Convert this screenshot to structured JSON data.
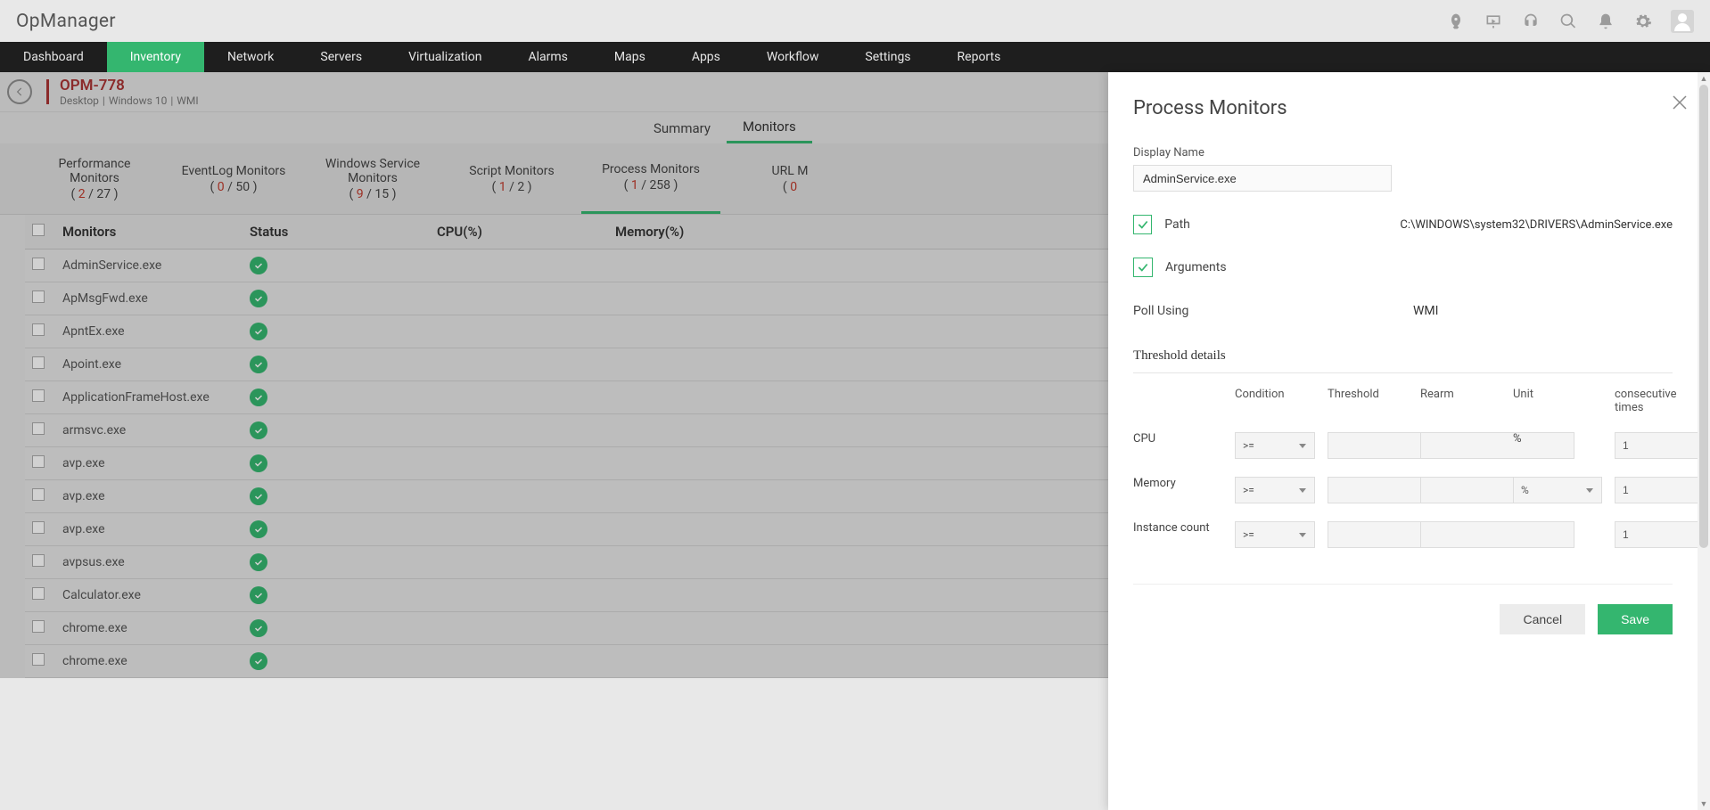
{
  "brand": "OpManager",
  "nav": [
    "Dashboard",
    "Inventory",
    "Network",
    "Servers",
    "Virtualization",
    "Alarms",
    "Maps",
    "Apps",
    "Workflow",
    "Settings",
    "Reports"
  ],
  "nav_active": 1,
  "device": {
    "name": "OPM-778",
    "meta": [
      "Desktop",
      "Windows 10",
      "WMI"
    ]
  },
  "subtabs": [
    "Summary",
    "Monitors"
  ],
  "subtab_active": 1,
  "mcats": [
    {
      "l1": "Performance",
      "l2": "Monitors",
      "a": "2",
      "b": "27"
    },
    {
      "l1": "EventLog Monitors",
      "l2": "",
      "a": "0",
      "b": "50"
    },
    {
      "l1": "Windows Service",
      "l2": "Monitors",
      "a": "9",
      "b": "15"
    },
    {
      "l1": "Script Monitors",
      "l2": "",
      "a": "1",
      "b": "2"
    },
    {
      "l1": "Process Monitors",
      "l2": "",
      "a": "1",
      "b": "258"
    },
    {
      "l1": "URL M",
      "l2": "",
      "a": "0",
      "b": ""
    }
  ],
  "mcat_active": 4,
  "table": {
    "headers": [
      "Monitors",
      "Status",
      "CPU(%)",
      "Memory(%)"
    ],
    "rows": [
      {
        "name": "AdminService.exe"
      },
      {
        "name": "ApMsgFwd.exe"
      },
      {
        "name": "ApntEx.exe"
      },
      {
        "name": "Apoint.exe"
      },
      {
        "name": "ApplicationFrameHost.exe"
      },
      {
        "name": "armsvc.exe"
      },
      {
        "name": "avp.exe"
      },
      {
        "name": "avp.exe"
      },
      {
        "name": "avp.exe"
      },
      {
        "name": "avpsus.exe"
      },
      {
        "name": "Calculator.exe"
      },
      {
        "name": "chrome.exe"
      },
      {
        "name": "chrome.exe"
      }
    ]
  },
  "panel": {
    "title": "Process Monitors",
    "display_name_label": "Display Name",
    "display_name_value": "AdminService.exe",
    "path_label": "Path",
    "path_value": "C:\\WINDOWS\\system32\\DRIVERS\\AdminService.exe",
    "args_label": "Arguments",
    "poll_label": "Poll Using",
    "poll_value": "WMI",
    "thresh_title": "Threshold details",
    "thresh_headers": [
      "",
      "Condition",
      "Threshold",
      "Rearm",
      "Unit",
      "consecutive times"
    ],
    "thresh_rows": [
      {
        "label": "CPU",
        "cond": ">=",
        "unit": "%",
        "unit_select": false,
        "ct": "1"
      },
      {
        "label": "Memory",
        "cond": ">=",
        "unit": "%",
        "unit_select": true,
        "ct": "1"
      },
      {
        "label": "Instance count",
        "cond": ">=",
        "unit": "",
        "unit_select": false,
        "ct": "1"
      }
    ],
    "cancel": "Cancel",
    "save": "Save"
  }
}
